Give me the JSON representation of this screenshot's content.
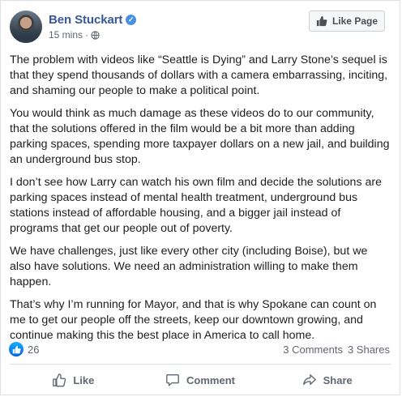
{
  "post": {
    "author": "Ben Stuckart",
    "timestamp": "15 mins",
    "separator": "·",
    "verified_mark": "✓",
    "like_page_label": "Like Page",
    "paragraphs": [
      "The problem with videos like “Seattle is Dying” and Larry Stone’s sequel is that they spend thousands of dollars with a camera embarrassing, inciting, and shaming our people to make a political point.",
      "You would think as much damage as these videos do to our community, that the solutions offered in the film would be a bit more than adding parking spaces, spending more taxpayer dollars on a new jail, and building an underground bus stop.",
      "I don’t see how Larry can watch his own film and decide the solutions are parking spaces instead of mental health treatment, underground bus stations instead of affordable housing, and a bigger jail instead of programs that get our people out of poverty.",
      "We have challenges, just like every other city (including Boise), but we also have solutions. We need an administration willing to make them happen.",
      "That’s why I’m running for Mayor, and that is why Spokane can count on me to get our people off the streets, keep our downtown growing, and continue making this the best place in America to call home."
    ]
  },
  "stats": {
    "reaction_count": "26",
    "comments": "3 Comments",
    "shares": "3 Shares"
  },
  "actions": {
    "like": "Like",
    "comment": "Comment",
    "share": "Share"
  },
  "icons": {
    "verified": "verified-badge-icon",
    "privacy": "globe-icon",
    "like_page": "thumbs-up-icon",
    "reaction": "like-reaction-icon",
    "comment": "speech-bubble-icon",
    "share": "share-arrow-icon"
  },
  "colors": {
    "brand_link": "#385898",
    "muted_text": "#606770",
    "reaction_blue": "#1877f2"
  }
}
